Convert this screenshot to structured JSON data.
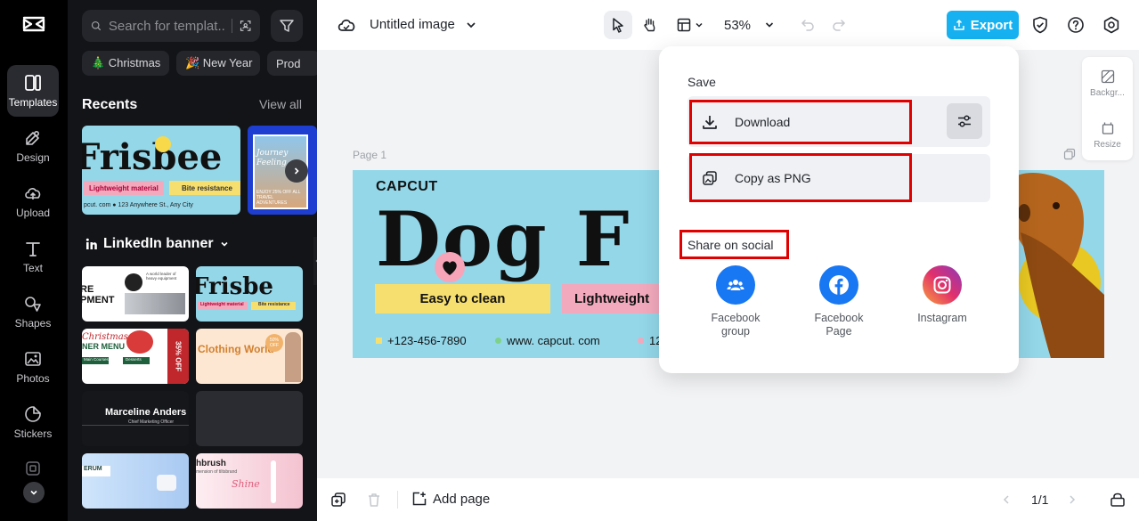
{
  "rail": {
    "items": [
      {
        "label": "Templates"
      },
      {
        "label": "Design"
      },
      {
        "label": "Upload"
      },
      {
        "label": "Text"
      },
      {
        "label": "Shapes"
      },
      {
        "label": "Photos"
      },
      {
        "label": "Stickers"
      }
    ]
  },
  "panel": {
    "search_placeholder": "Search for templat...",
    "chips": [
      "🎄 Christmas",
      "🎉 New Year",
      "Prod"
    ],
    "recents_title": "Recents",
    "view_all": "View all",
    "linkedin_title": "LinkedIn banner",
    "recents": [
      {
        "title": "Frisbee",
        "tag1": "Lightweight material",
        "tag2": "Bite resistance",
        "footer": "pcut. com   ● 123 Anywhere St., Any City"
      },
      {
        "title": "Journey Feeling",
        "promo": "ENJOY 25% OFF ALL TRAVEL ADVENTURES"
      }
    ],
    "grid": [
      {
        "title": "RE PMENT",
        "note": "A world leader of heavy equipment"
      },
      {
        "title": "Frisbe",
        "tag1": "Lightweight material",
        "tag2": "Bite resistance"
      },
      {
        "title": "Christmas",
        "sub": "NER MENU",
        "tag1": "Main Courses",
        "tag2": "Desserts",
        "badge": "35% OFF"
      },
      {
        "title": "Clothing World",
        "badge": "50% OFF"
      },
      {
        "title": "Marceline Anders",
        "sub": "Chief Marketing Officer"
      },
      {
        "title": ""
      },
      {
        "title": "ERUM"
      },
      {
        "title": "hbrush",
        "sub": "mension of tiltsbrand",
        "sig": "Shine"
      }
    ]
  },
  "topbar": {
    "doc_title": "Untitled image",
    "zoom": "53%",
    "export_label": "Export"
  },
  "canvas": {
    "page_label": "Page 1",
    "banner": {
      "brand": "CAPCUT",
      "headline": "Dog F",
      "pill1": "Easy to clean",
      "pill2": "Lightweight",
      "phone": "+123-456-7890",
      "web": "www. capcut. com",
      "addr": "12"
    }
  },
  "right_tools": [
    {
      "label": "Backgr..."
    },
    {
      "label": "Resize"
    }
  ],
  "bottombar": {
    "add_page": "Add page",
    "pager": "1/1"
  },
  "popover": {
    "save_title": "Save",
    "download": "Download",
    "copy_png": "Copy as PNG",
    "share_title": "Share on social",
    "socials": [
      {
        "label_line1": "Facebook",
        "label_line2": "group",
        "color": "#1877f2"
      },
      {
        "label_line1": "Facebook",
        "label_line2": "Page",
        "color": "#1877f2"
      },
      {
        "label_line1": "Instagram",
        "label_line2": "",
        "color": "#e1306c"
      }
    ]
  },
  "colors": {
    "accent": "#16b1f0",
    "highlight_red": "#e00000",
    "banner_bg": "#93d7e9",
    "pill_yellow": "#f6df6e",
    "pill_pink": "#f3a9bd"
  }
}
